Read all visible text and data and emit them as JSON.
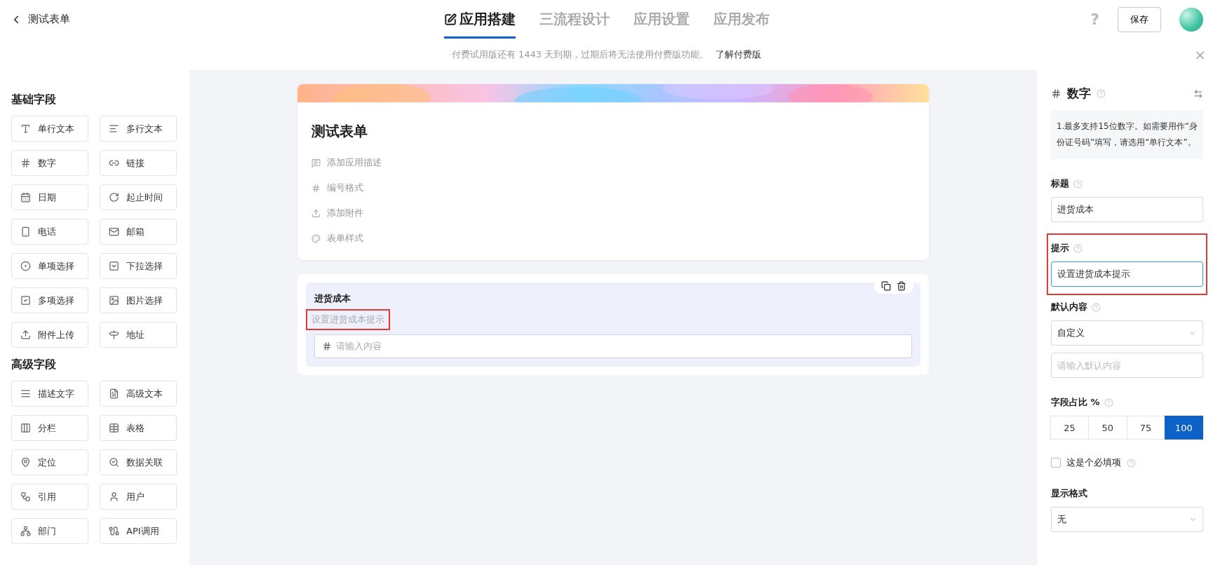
{
  "header": {
    "back_title": "测试表单",
    "tabs": [
      {
        "label": "应用搭建",
        "selected": true
      },
      {
        "label": "三流程设计",
        "selected": false
      },
      {
        "label": "应用设置",
        "selected": false
      },
      {
        "label": "应用发布",
        "selected": false
      }
    ],
    "help": "?",
    "save": "保存"
  },
  "notice": {
    "text": "付费试用版还有 1443 天到期，过期后将无法使用付费版功能。",
    "link": "了解付费版",
    "close": "×"
  },
  "sidebar": {
    "groups": [
      {
        "title": "基础字段",
        "items": [
          {
            "label": "单行文本"
          },
          {
            "label": "多行文本"
          },
          {
            "label": "数字"
          },
          {
            "label": "链接"
          },
          {
            "label": "日期"
          },
          {
            "label": "起止时间"
          },
          {
            "label": "电话"
          },
          {
            "label": "邮箱"
          },
          {
            "label": "单项选择"
          },
          {
            "label": "下拉选择"
          },
          {
            "label": "多项选择"
          },
          {
            "label": "图片选择"
          },
          {
            "label": "附件上传"
          },
          {
            "label": "地址"
          }
        ]
      },
      {
        "title": "高级字段",
        "items": [
          {
            "label": "描述文字"
          },
          {
            "label": "高级文本"
          },
          {
            "label": "分栏"
          },
          {
            "label": "表格"
          },
          {
            "label": "定位"
          },
          {
            "label": "数据关联"
          },
          {
            "label": "引用"
          },
          {
            "label": "用户"
          },
          {
            "label": "部门"
          },
          {
            "label": "API调用"
          }
        ]
      }
    ]
  },
  "form": {
    "title": "测试表单",
    "actions": [
      "添加应用描述",
      "编号格式",
      "添加附件",
      "表单样式"
    ],
    "field": {
      "label": "进货成本",
      "hint": "设置进货成本提示",
      "hint_highlighted": true,
      "placeholder": "请输入内容"
    }
  },
  "properties": {
    "type": "数字",
    "note": "1.最多支持15位数字。如需要用作“身份证号码”填写，请选用“单行文本”。",
    "title": {
      "label": "标题",
      "value": "进货成本"
    },
    "hint": {
      "label": "提示",
      "value": "设置进货成本提示",
      "highlighted": true
    },
    "default_label": "默认内容",
    "default_select": "自定义",
    "default_placeholder": "请输入默认内容",
    "ratio_label": "字段占比 %",
    "ratios": [
      {
        "label": "25",
        "selected": false
      },
      {
        "label": "50",
        "selected": false
      },
      {
        "label": "75",
        "selected": false
      },
      {
        "label": "100",
        "selected": true
      }
    ],
    "required": {
      "label": "这是个必填项",
      "checked": false
    },
    "format_label": "显示格式",
    "format_select": "无"
  }
}
